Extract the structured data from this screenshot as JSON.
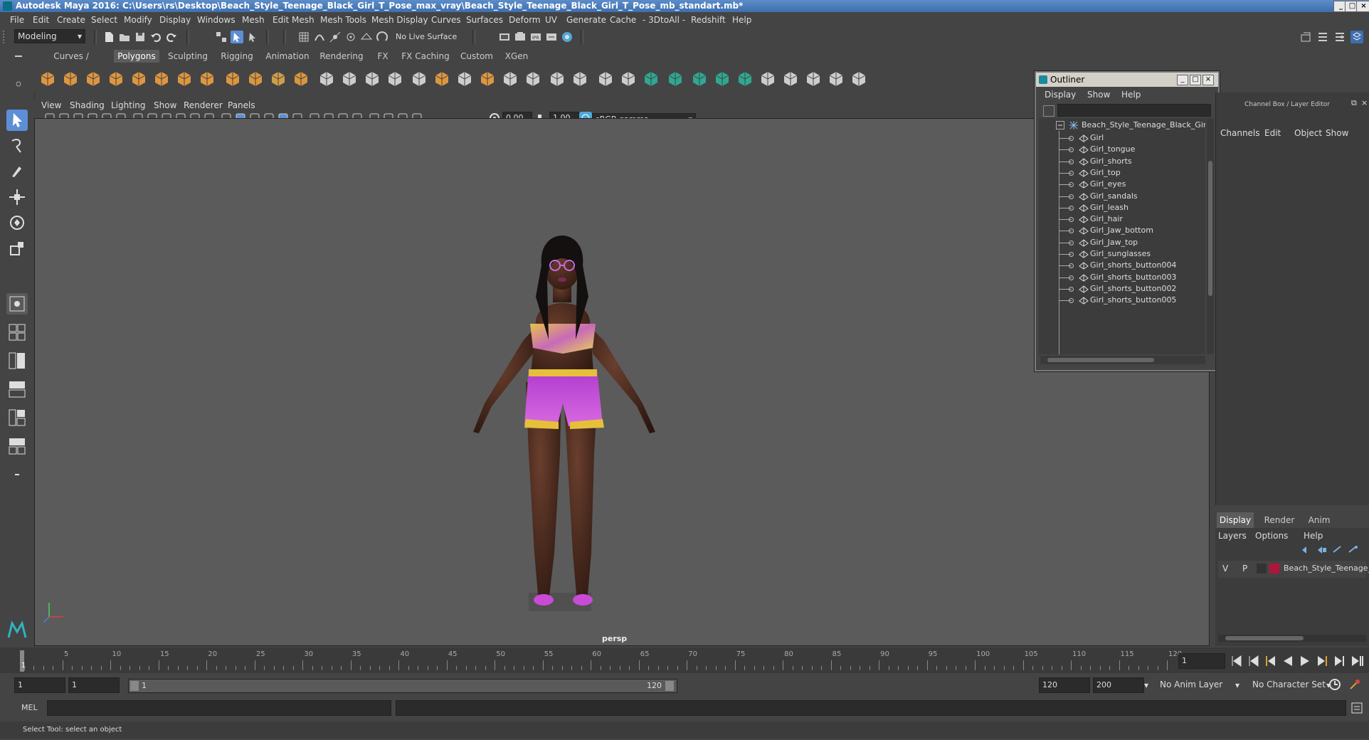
{
  "window": {
    "title": "Autodesk Maya 2016: C:\\Users\\rs\\Desktop\\Beach_Style_Teenage_Black_Girl_T_Pose_max_vray\\Beach_Style_Teenage_Black_Girl_T_Pose_mb_standart.mb*",
    "controls": [
      "_",
      "□",
      "×"
    ]
  },
  "menubar": [
    "File",
    "Edit",
    "Create",
    "Select",
    "Modify",
    "Display",
    "Windows",
    "Mesh",
    "Edit Mesh",
    "Mesh Tools",
    "Mesh Display",
    "Curves",
    "Surfaces",
    "Deform",
    "UV",
    "Generate",
    "Cache",
    "- 3DtoAll -",
    "Redshift",
    "Help"
  ],
  "status_line": {
    "mode": "Modeling",
    "live_surface": "No Live Surface"
  },
  "shelf_tabs": [
    "Curves / Surfaces",
    "Polygons",
    "Sculpting",
    "Rigging",
    "Animation",
    "Rendering",
    "FX",
    "FX Caching",
    "Custom",
    "XGen"
  ],
  "shelf_active_tab": "Polygons",
  "panel_menu": [
    "View",
    "Shading",
    "Lighting",
    "Show",
    "Renderer",
    "Panels"
  ],
  "panel_toolbar": {
    "exposure": "0.00",
    "gamma_value": "1.00",
    "color_space": "sRGB gamma"
  },
  "viewport": {
    "camera": "persp"
  },
  "outliner": {
    "title": "Outliner",
    "menu": [
      "Display",
      "Show",
      "Help"
    ],
    "root": "Beach_Style_Teenage_Black_Girl_T",
    "items": [
      "Girl",
      "Girl_tongue",
      "Girl_shorts",
      "Girl_top",
      "Girl_eyes",
      "Girl_sandals",
      "Girl_leash",
      "Girl_hair",
      "Girl_Jaw_bottom",
      "Girl_Jaw_top",
      "Girl_sunglasses",
      "Girl_shorts_button004",
      "Girl_shorts_button003",
      "Girl_shorts_button002",
      "Girl_shorts_button005"
    ]
  },
  "channel_box": {
    "title": "Channel Box / Layer Editor",
    "menu": [
      "Channels",
      "Edit",
      "Object",
      "Show"
    ]
  },
  "layer_editor": {
    "tabs": [
      "Display",
      "Render",
      "Anim"
    ],
    "active_tab": "Display",
    "menu": [
      "Layers",
      "Options",
      "Help"
    ],
    "layer": {
      "visible": "V",
      "playback": "P",
      "name": "Beach_Style_Teenage_I",
      "color": "#b0153a"
    }
  },
  "timeline": {
    "ticks": [
      "5",
      "10",
      "15",
      "20",
      "25",
      "30",
      "35",
      "40",
      "45",
      "50",
      "55",
      "60",
      "65",
      "70",
      "75",
      "80",
      "85",
      "90",
      "95",
      "100",
      "105",
      "110",
      "115",
      "120"
    ],
    "start_marker": "1",
    "current_frame": "1"
  },
  "range": {
    "start": "1",
    "playback_start": "1",
    "slider_start": "1",
    "slider_end": "120",
    "playback_end": "120",
    "end": "200",
    "anim_layer": "No Anim Layer",
    "character_set": "No Character Set"
  },
  "command_line": {
    "language": "MEL"
  },
  "help_line": "Select Tool: select an object",
  "colors": {
    "accent": "#5c8fd6",
    "shelf_orange": "#f0a040",
    "shelf_teal": "#2fb39a"
  }
}
